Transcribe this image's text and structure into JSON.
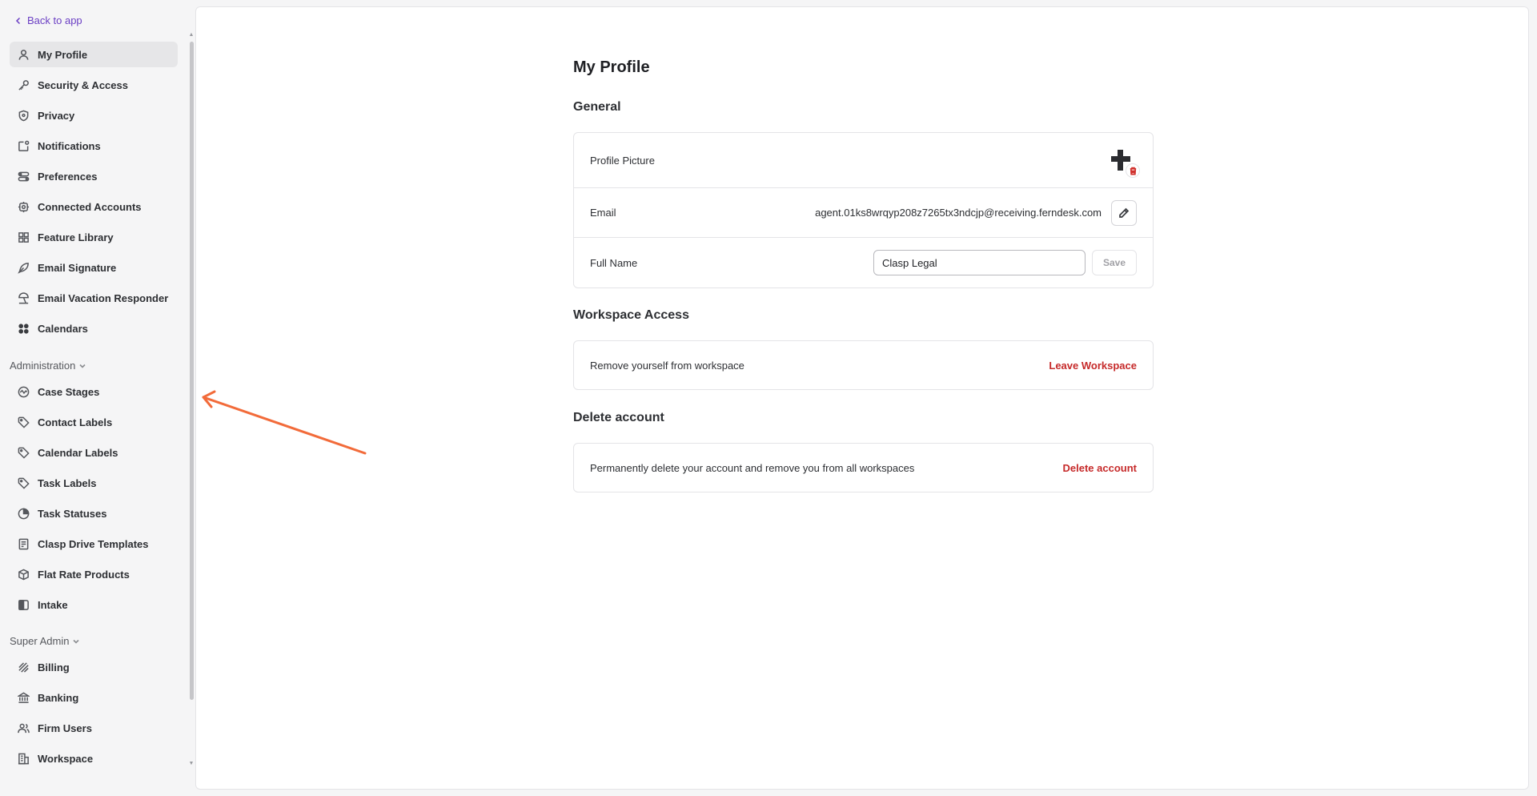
{
  "sidebar": {
    "back_label": "Back to app",
    "items": [
      {
        "label": "My Profile",
        "icon": "user-icon",
        "active": true
      },
      {
        "label": "Security & Access",
        "icon": "key-icon"
      },
      {
        "label": "Privacy",
        "icon": "shield-icon"
      },
      {
        "label": "Notifications",
        "icon": "notification-icon"
      },
      {
        "label": "Preferences",
        "icon": "toggles-icon"
      },
      {
        "label": "Connected Accounts",
        "icon": "plug-icon"
      },
      {
        "label": "Feature Library",
        "icon": "grid-icon"
      },
      {
        "label": "Email Signature",
        "icon": "pen-nib-icon"
      },
      {
        "label": "Email Vacation Responder",
        "icon": "beach-umbrella-icon"
      },
      {
        "label": "Calendars",
        "icon": "apps-icon"
      }
    ],
    "administration": {
      "label": "Administration",
      "items": [
        {
          "label": "Case Stages",
          "icon": "pulse-icon"
        },
        {
          "label": "Contact Labels",
          "icon": "tag-icon"
        },
        {
          "label": "Calendar Labels",
          "icon": "tag-icon"
        },
        {
          "label": "Task Labels",
          "icon": "tag-icon"
        },
        {
          "label": "Task Statuses",
          "icon": "pie-icon"
        },
        {
          "label": "Clasp Drive Templates",
          "icon": "document-icon"
        },
        {
          "label": "Flat Rate Products",
          "icon": "box-icon"
        },
        {
          "label": "Intake",
          "icon": "half-square-icon"
        }
      ]
    },
    "super_admin": {
      "label": "Super Admin",
      "items": [
        {
          "label": "Billing",
          "icon": "stripe-icon"
        },
        {
          "label": "Banking",
          "icon": "bank-icon"
        },
        {
          "label": "Firm Users",
          "icon": "users-icon"
        },
        {
          "label": "Workspace",
          "icon": "building-icon"
        }
      ]
    }
  },
  "main": {
    "title": "My Profile",
    "general": {
      "title": "General",
      "profile_picture_label": "Profile Picture",
      "email_label": "Email",
      "email_value": "agent.01ks8wrqyp208z7265tx3ndcjp@receiving.ferndesk.com",
      "full_name_label": "Full Name",
      "full_name_value": "Clasp Legal",
      "save_label": "Save"
    },
    "workspace_access": {
      "title": "Workspace Access",
      "description": "Remove yourself from workspace",
      "action": "Leave Workspace"
    },
    "delete_account": {
      "title": "Delete account",
      "description": "Permanently delete your account and remove you from all workspaces",
      "action": "Delete account"
    }
  },
  "colors": {
    "accent": "#6b3fc4",
    "danger": "#c62a2a",
    "annotation_arrow": "#f26b3a"
  }
}
